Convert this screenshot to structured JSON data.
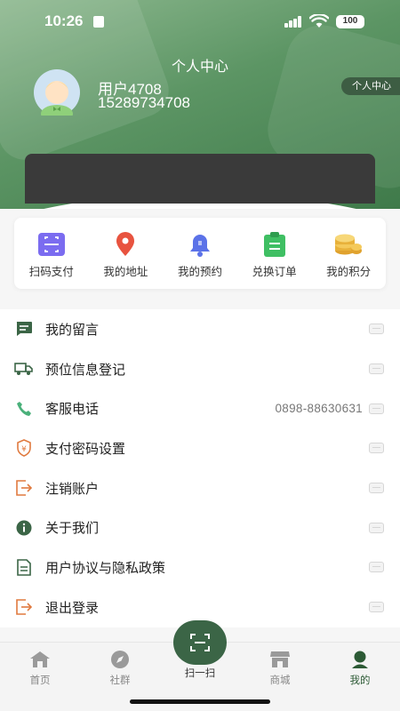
{
  "status": {
    "time": "10:26",
    "battery": "100"
  },
  "header": {
    "title": "个人中心",
    "username": "用户4708",
    "phone": "15289734708",
    "badge": "个人中心"
  },
  "quick_actions": [
    {
      "label": "扫码支付",
      "icon": "scan-pay-icon",
      "color": "#7b6cf0"
    },
    {
      "label": "我的地址",
      "icon": "location-pin-icon",
      "color": "#e8533f"
    },
    {
      "label": "我的预约",
      "icon": "bell-icon",
      "color": "#5b72e8"
    },
    {
      "label": "兑换订单",
      "icon": "clipboard-icon",
      "color": "#3fbf63"
    },
    {
      "label": "我的积分",
      "icon": "coins-icon",
      "color": "#e8b13a"
    }
  ],
  "menu": [
    {
      "label": "我的留言",
      "icon": "message-icon",
      "value": ""
    },
    {
      "label": "预位信息登记",
      "icon": "truck-icon",
      "value": ""
    },
    {
      "label": "客服电话",
      "icon": "phone-icon",
      "value": "0898-88630631"
    },
    {
      "label": "支付密码设置",
      "icon": "shield-yuan-icon",
      "value": ""
    },
    {
      "label": "注销账户",
      "icon": "logout-box-icon",
      "value": ""
    },
    {
      "label": "关于我们",
      "icon": "info-icon",
      "value": ""
    },
    {
      "label": "用户协议与隐私政策",
      "icon": "document-icon",
      "value": ""
    },
    {
      "label": "退出登录",
      "icon": "exit-icon",
      "value": ""
    }
  ],
  "tabbar": {
    "tabs": [
      {
        "label": "首页",
        "icon": "home-icon"
      },
      {
        "label": "社群",
        "icon": "compass-icon"
      },
      {
        "label": "商城",
        "icon": "store-icon"
      },
      {
        "label": "我的",
        "icon": "user-icon",
        "active": true
      }
    ],
    "scan_label": "扫一扫"
  },
  "colors": {
    "brand_green": "#3b6546",
    "header_green": "#5c9564",
    "accent_orange": "#e07a3f"
  }
}
